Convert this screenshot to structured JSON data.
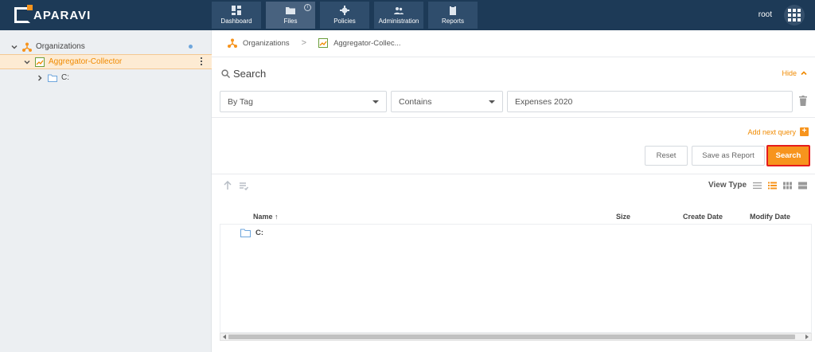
{
  "app": {
    "logo": "APARAVI",
    "user": "root"
  },
  "nav": [
    {
      "label": "Dashboard",
      "icon": "dashboard-icon"
    },
    {
      "label": "Files",
      "icon": "folder-icon",
      "active": true
    },
    {
      "label": "Policies",
      "icon": "gear-icon"
    },
    {
      "label": "Administration",
      "icon": "users-icon"
    },
    {
      "label": "Reports",
      "icon": "clipboard-icon"
    }
  ],
  "sidebar": {
    "items": [
      {
        "label": "Organizations",
        "icon": "organization-icon"
      },
      {
        "label": "Aggregator-Collector",
        "icon": "aggregator-icon"
      },
      {
        "label": "C:",
        "icon": "folder-icon"
      }
    ]
  },
  "breadcrumb": {
    "items": [
      "Organizations",
      "Aggregator-Collec..."
    ]
  },
  "search": {
    "title": "Search",
    "hide_label": "Hide",
    "field_select": "By Tag",
    "operator_select": "Contains",
    "value": "Expenses 2020",
    "add_query_label": "Add next query",
    "reset_label": "Reset",
    "save_report_label": "Save as Report",
    "search_label": "Search"
  },
  "results": {
    "view_type_label": "View Type",
    "columns": [
      "Name",
      "Size",
      "Create Date",
      "Modify Date"
    ],
    "rows": [
      {
        "name": "C:",
        "icon": "folder-icon"
      }
    ]
  },
  "colors": {
    "topbar": "#1d3a57",
    "accent": "#f7941d",
    "highlight_border": "#e51c1c"
  }
}
